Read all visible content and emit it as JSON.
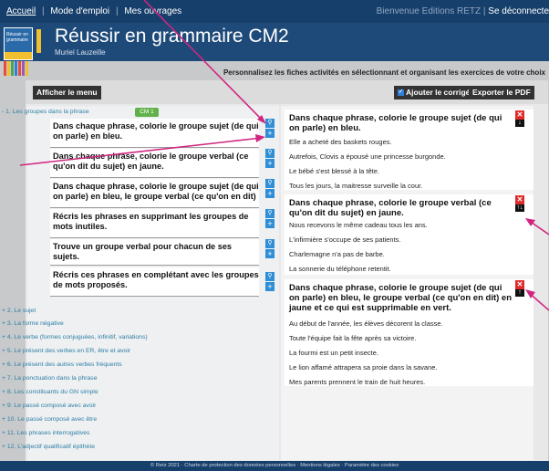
{
  "nav": {
    "home": "Accueil",
    "sep": "|",
    "my_space": "Mode d'emploi",
    "my_books": "Mes ouvrages",
    "welcome": "Bienvenue Editions RETZ |",
    "logout": "Se déconnecte"
  },
  "header": {
    "cover_text": "Réussir en grammaire",
    "title": "Réussir en grammaire CM2",
    "author": "Muriel Lauzeille",
    "personalize": "Personnalisez les fiches activités en sélectionnant et organisant les exercices de votre choix"
  },
  "toolbar": {
    "menu_label": "Afficher le menu",
    "add_answer_label": "Ajouter le corrigé",
    "export_label": "Exporter le PDF",
    "check_mark": "✓"
  },
  "sidebar": {
    "open_chapter": "- 1. Les groupes dans la phrase",
    "level_badge": "CM 1",
    "exercises": [
      {
        "text": "Dans chaque phrase, colorie le groupe sujet (de qui on parle) en bleu."
      },
      {
        "text": "Dans chaque phrase, colorie le groupe verbal (ce qu'on dit du sujet) en jaune."
      },
      {
        "text": "Dans chaque phrase, colorie le groupe sujet (de qui on parle) en bleu, le groupe verbal (ce qu'on en dit)"
      },
      {
        "text": "Récris les phrases en supprimant les groupes de mots inutiles."
      },
      {
        "text": "Trouve un groupe verbal pour chacun de ses sujets."
      },
      {
        "text": "Récris ces phrases en complétant avec les groupes de mots proposés."
      }
    ],
    "view_icon": "⚲",
    "add_icon": "+",
    "chapters": [
      "+ 2. Le sujet",
      "+ 3. La forme négative",
      "+ 4. Le verbe (formes conjuguées, infinitif, variations)",
      "+ 5. Le présent des verbes en ER, être et avoir",
      "+ 6. Le présent des autres verbes fréquents",
      "+ 7. La ponctuation dans la phrase",
      "+ 8. Les constituants du GN simple",
      "+ 9. Le passé composé avec avoir",
      "+ 10. Le passé composé avec être",
      "+ 11. Les phrases interrogatives",
      "+ 12. L'adjectif qualificatif épithète"
    ]
  },
  "selected": {
    "delete_icon": "✕",
    "cards": [
      {
        "title": "Dans chaque phrase, colorie le groupe sujet (de qui on parle) en bleu.",
        "sentences": [
          "Elle a acheté des baskets rouges.",
          "Autrefois, Clovis a épousé une princesse burgonde.",
          "Le bébé s'est blessé à la tête.",
          "Tous les jours, la maitresse surveille la cour."
        ],
        "move_icon": "↓"
      },
      {
        "title": "Dans chaque phrase, colorie le groupe verbal (ce qu'on dit du sujet) en jaune.",
        "sentences": [
          "Nous recevons le même cadeau tous les ans.",
          "L'infirmière s'occupe de ses patients.",
          "Charlemagne n'a pas de barbe.",
          "La sonnerie du téléphone retentit."
        ],
        "move_icon": "↑↓"
      },
      {
        "title": "Dans chaque phrase, colorie le groupe sujet (de qui on parle) en bleu, le groupe verbal (ce qu'on en dit) en jaune et ce qui est supprimable en vert.",
        "sentences": [
          "Au début de l'année, les élèves décorent la classe.",
          "Toute l'équipe fait la fête après sa victoire.",
          "La fourmi est un petit insecte.",
          "Le lion affamé attrapera sa proie dans la savane.",
          "Mes parents prennent le train de huit heures."
        ],
        "move_icon": "↑"
      }
    ]
  },
  "footer": {
    "text": "© Retz 2021 · Charte de protection des données personnelles · Mentions légales · Paramètre des cookies"
  },
  "colors": {
    "annotation_arrow": "#d0267f",
    "top_bar": "#173f6b",
    "accent_yellow": "#f2c02e",
    "link_blue": "#2c7ea6",
    "badge_green": "#62b14a",
    "delete_red": "#e02b2b"
  }
}
